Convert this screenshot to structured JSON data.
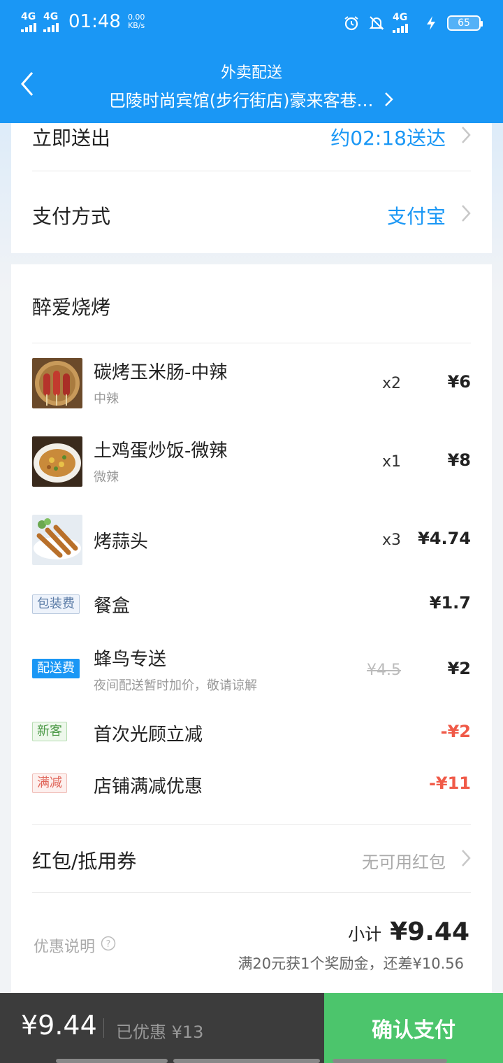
{
  "status_bar": {
    "net1": "4G",
    "net2": "4G",
    "time": "01:48",
    "speed_value": "0.00",
    "speed_unit": "KB/s",
    "net3": "4G",
    "battery": "65"
  },
  "header": {
    "title": "外卖配送",
    "address": "巴陵时尚宾馆(步行街店)豪来客巷…"
  },
  "delivery": {
    "label": "立即送出",
    "eta": "约02:18送达"
  },
  "payment": {
    "label": "支付方式",
    "method": "支付宝"
  },
  "shop": {
    "name": "醉爱烧烤",
    "items": [
      {
        "name": "碳烤玉米肠-中辣",
        "spec": "中辣",
        "qty": "x2",
        "price": "¥6"
      },
      {
        "name": "土鸡蛋炒饭-微辣",
        "spec": "微辣",
        "qty": "x1",
        "price": "¥8"
      },
      {
        "name": "烤蒜头",
        "spec": "",
        "qty": "x3",
        "price": "¥4.74"
      }
    ]
  },
  "fees": {
    "packaging": {
      "tag": "包装费",
      "name": "餐盒",
      "price": "¥1.7"
    },
    "delivery": {
      "tag": "配送费",
      "name": "蜂鸟专送",
      "note": "夜间配送暂时加价，敬请谅解",
      "original": "¥4.5",
      "price": "¥2"
    }
  },
  "discounts": {
    "new_customer": {
      "tag": "新客",
      "name": "首次光顾立减",
      "amount": "-¥2"
    },
    "full_reduction": {
      "tag": "满减",
      "name": "店铺满减优惠",
      "amount": "-¥11"
    }
  },
  "coupon": {
    "label": "红包/抵用券",
    "value": "无可用红包"
  },
  "summary": {
    "discount_note": "优惠说明",
    "subtotal_label": "小计",
    "subtotal": "¥9.44",
    "reward_hint": "满20元获1个奖励金，还差¥10.56"
  },
  "bottom_bar": {
    "total": "¥9.44",
    "saved": "已优惠 ¥13",
    "confirm": "确认支付"
  },
  "colors": {
    "brand_blue": "#1a97f5",
    "confirm_green": "#4cc56c",
    "discount_red": "#f05a48"
  }
}
